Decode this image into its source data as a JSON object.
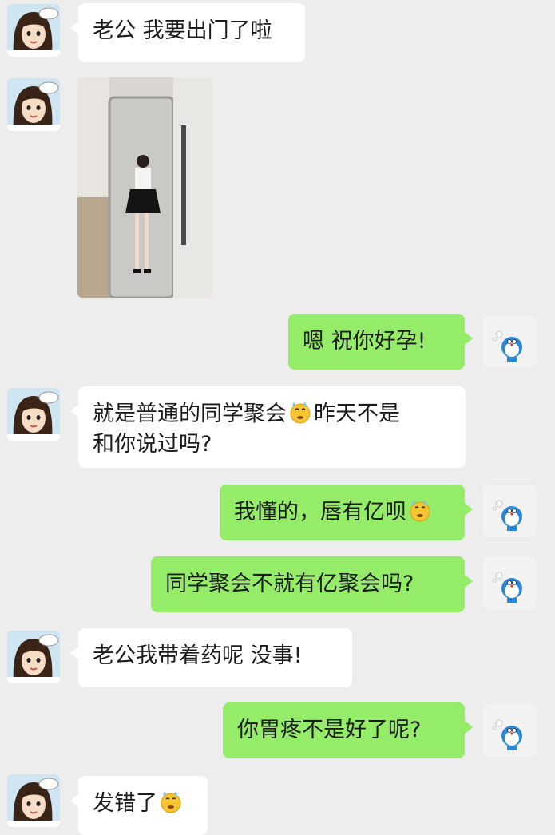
{
  "chat": {
    "messages": [
      {
        "side": "left",
        "type": "text",
        "text": "老公 我要出门了啦"
      },
      {
        "side": "left",
        "type": "image",
        "description_icon": "photo-mirror-selfie"
      },
      {
        "side": "right",
        "type": "text",
        "text": "嗯 祝你好孕!"
      },
      {
        "side": "left",
        "type": "text",
        "parts": [
          "就是普通的同学聚会",
          "昨天不是",
          "和你说过吗?"
        ],
        "emoji_icon": "sweat-emoji-icon"
      },
      {
        "side": "right",
        "type": "text",
        "parts": [
          "我懂的，唇有亿呗"
        ],
        "emoji_icon": "sweat-emoji-icon"
      },
      {
        "side": "right",
        "type": "text",
        "text": "同学聚会不就有亿聚会吗?"
      },
      {
        "side": "left",
        "type": "text",
        "text": "老公我带着药呢 没事!"
      },
      {
        "side": "right",
        "type": "text",
        "text": "你胃疼不是好了呢?"
      },
      {
        "side": "left",
        "type": "text",
        "parts": [
          "发错了"
        ],
        "emoji_icon": "sweat-emoji-icon"
      }
    ]
  },
  "avatars": {
    "left": "girl-cartoon-avatar-icon",
    "right": "doraemon-avatar-icon"
  },
  "colors": {
    "background": "#ededed",
    "incoming_bubble": "#ffffff",
    "outgoing_bubble": "#95ec69"
  }
}
